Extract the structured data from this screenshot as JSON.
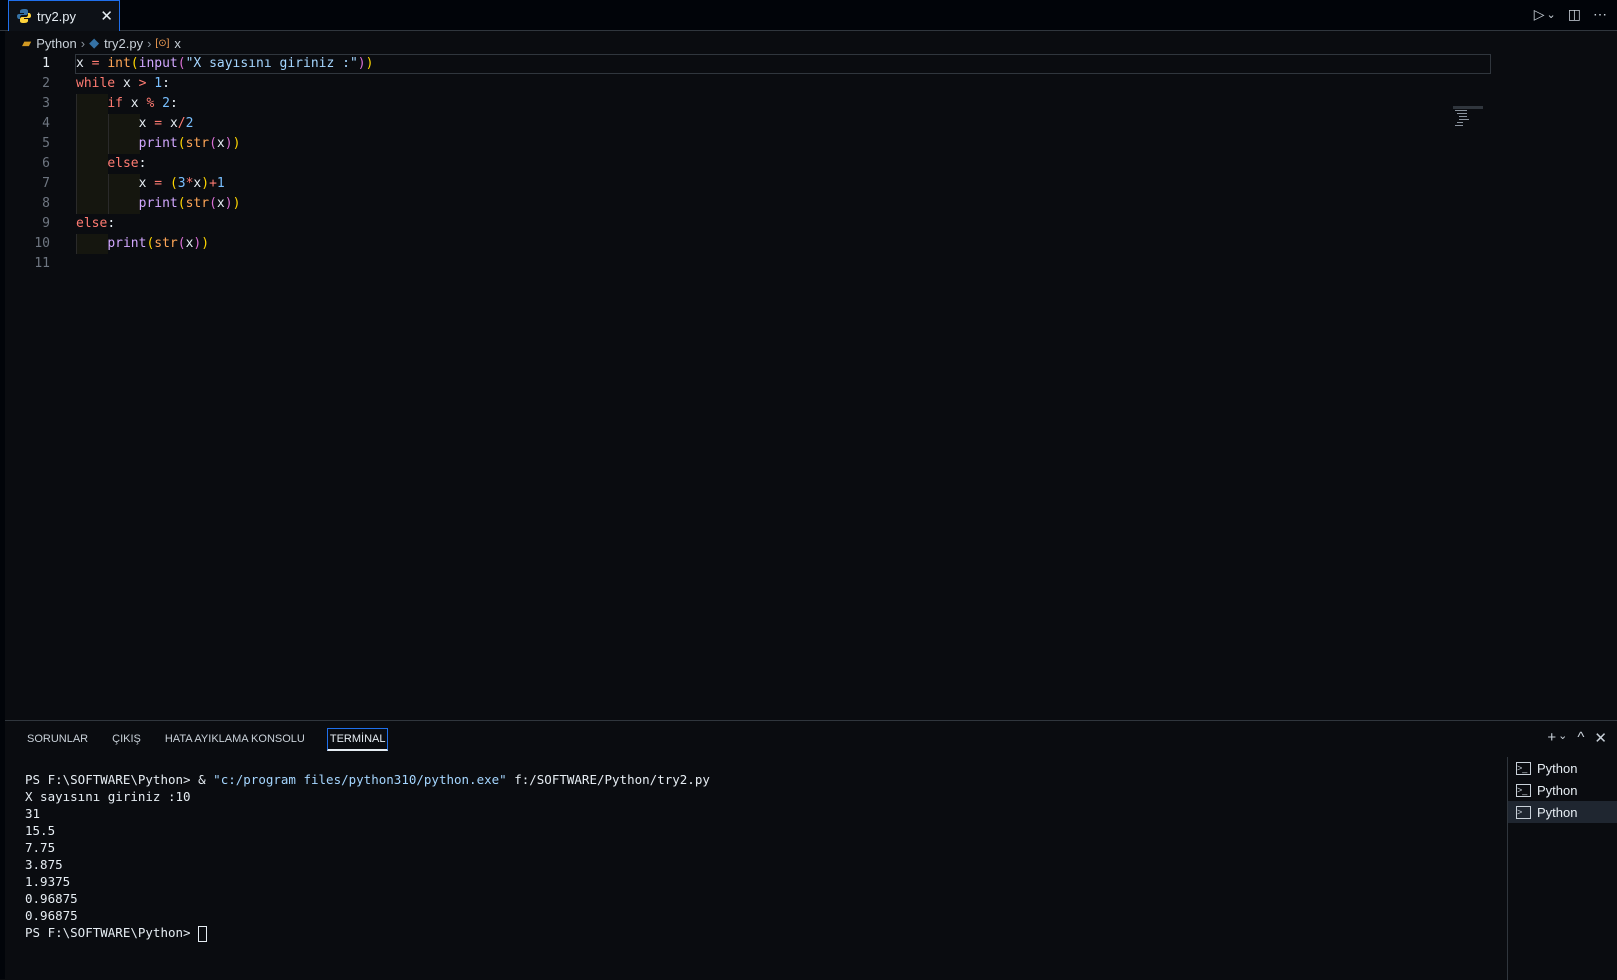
{
  "tab": {
    "filename": "try2.py",
    "close": "✕"
  },
  "toolbar": {
    "run": "▷",
    "run_menu": "⌄",
    "split": "◫",
    "more": "⋯"
  },
  "breadcrumb": {
    "folder": "Python",
    "file": "try2.py",
    "symbol": "x"
  },
  "editor": {
    "line_numbers": [
      "1",
      "2",
      "3",
      "4",
      "5",
      "6",
      "7",
      "8",
      "9",
      "10",
      "11"
    ]
  },
  "panel": {
    "tabs": [
      "SORUNLAR",
      "ÇIKIŞ",
      "HATA AYIKLAMA KONSOLU",
      "TERMİNAL"
    ],
    "active_tab": "TERMİNAL",
    "actions": {
      "add": "+",
      "add_menu": "⌄",
      "maximize": "^",
      "close": "✕"
    }
  },
  "terminal": {
    "prompt": "PS F:\\SOFTWARE\\Python>",
    "command_op": "&",
    "command_path": "\"c:/program files/python310/python.exe\"",
    "command_arg": "f:/SOFTWARE/Python/try2.py",
    "input_line": "X sayısını giriniz :10",
    "outputs": [
      "31",
      "15.5",
      "7.75",
      "3.875",
      "1.9375",
      "0.96875",
      "0.96875"
    ],
    "final_prompt": "PS F:\\SOFTWARE\\Python>"
  },
  "terminal_list": [
    {
      "label": "Python"
    },
    {
      "label": "Python"
    },
    {
      "label": "Python"
    }
  ],
  "colors": {
    "accent": "#1f6feb",
    "background": "#0a0c10"
  }
}
